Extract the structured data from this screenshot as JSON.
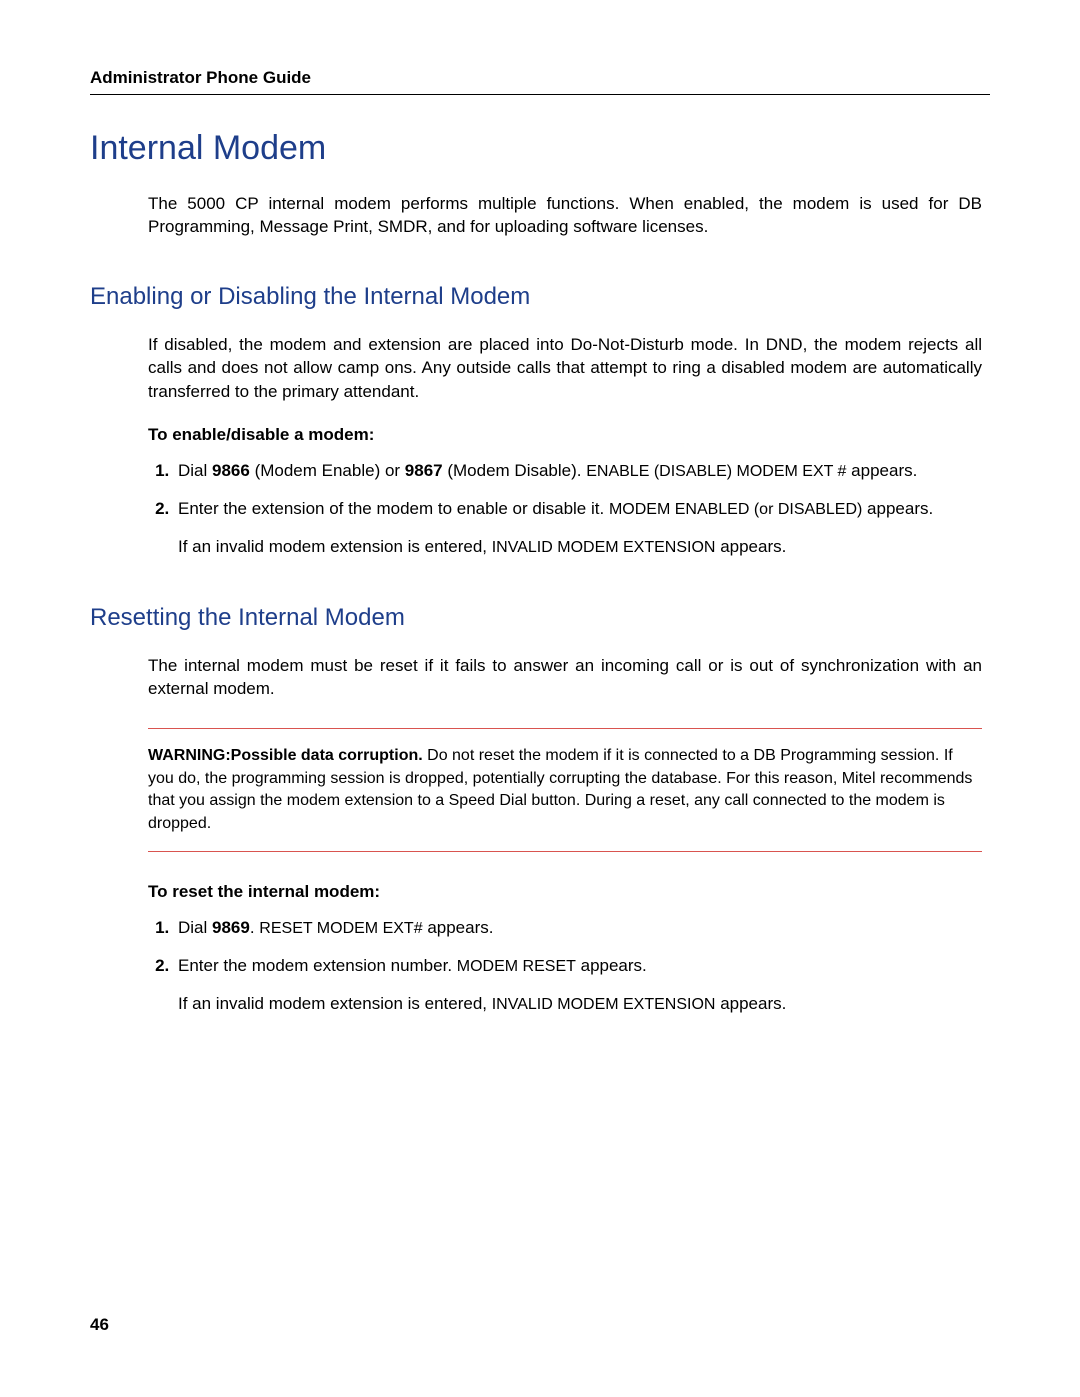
{
  "header": {
    "running": "Administrator Phone Guide"
  },
  "title": "Internal Modem",
  "intro": "The 5000 CP internal modem performs multiple functions. When enabled, the modem is used for DB Programming, Message Print, SMDR, and for uploading software licenses.",
  "enable": {
    "title": "Enabling or Disabling the Internal Modem",
    "para": "If disabled, the modem and extension are placed into Do-Not-Disturb mode. In DND, the modem rejects all calls and does not allow camp ons. Any outside calls that attempt to ring a disabled modem are automatically transferred to the primary attendant.",
    "instr_head": "To enable/disable a modem:",
    "step1_a": "Dial ",
    "step1_code1": "9866",
    "step1_b": " (Modem Enable) or ",
    "step1_code2": "9867",
    "step1_c": " (Modem Disable). ",
    "step1_msg": "ENABLE (DISABLE) MODEM EXT #",
    "step1_d": " appears.",
    "step2_a": "Enter the extension of the modem to enable or disable it. ",
    "step2_msg": "MODEM ENABLED (or DISABLED)",
    "step2_b": " appears.",
    "after_a": "If an invalid modem extension is entered, ",
    "after_msg": "INVALID MODEM EXTENSION",
    "after_b": " appears."
  },
  "reset": {
    "title": "Resetting the Internal Modem",
    "para": "The internal modem must be reset if it fails to answer an incoming call or is out of synchronization with an external modem.",
    "warning_lead": "WARNING:Possible data corruption.",
    "warning_body": " Do not reset the modem if it is connected to a DB Programming session. If you do, the programming session is dropped, potentially corrupting the database. For this reason, Mitel recommends that you assign the modem extension to a Speed Dial button. During a reset, any call connected to the modem is dropped.",
    "instr_head": "To reset the internal modem:",
    "step1_a": "Dial ",
    "step1_code": "9869",
    "step1_b": ". ",
    "step1_msg": "RESET MODEM EXT#",
    "step1_c": " appears.",
    "step2_a": "Enter the modem extension number. ",
    "step2_msg": "MODEM RESET",
    "step2_b": " appears.",
    "after_a": "If an invalid modem extension is entered, ",
    "after_msg": "INVALID MODEM EXTENSION",
    "after_b": " appears."
  },
  "page_number": "46"
}
